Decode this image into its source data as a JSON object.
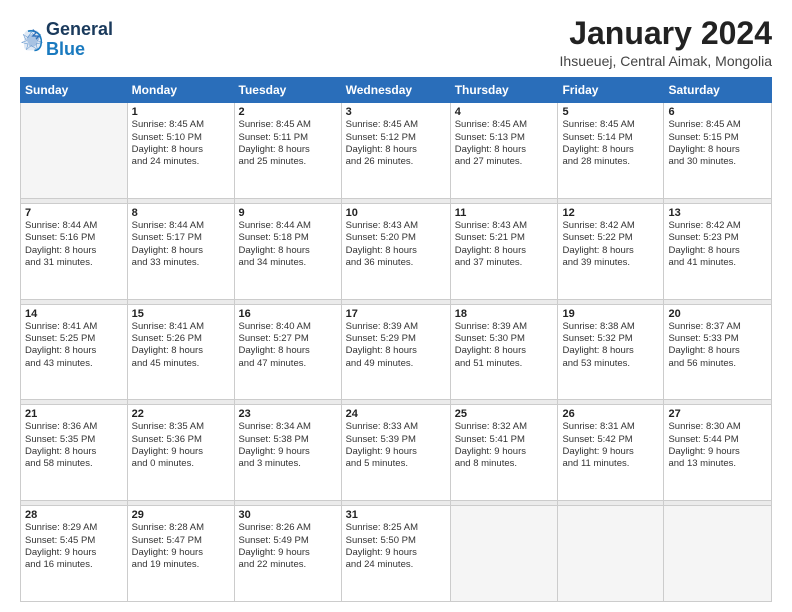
{
  "header": {
    "logo_line1": "General",
    "logo_line2": "Blue",
    "month_title": "January 2024",
    "location": "Ihsueuej, Central Aimak, Mongolia"
  },
  "days_of_week": [
    "Sunday",
    "Monday",
    "Tuesday",
    "Wednesday",
    "Thursday",
    "Friday",
    "Saturday"
  ],
  "weeks": [
    {
      "days": [
        {
          "num": "",
          "content": ""
        },
        {
          "num": "1",
          "content": "Sunrise: 8:45 AM\nSunset: 5:10 PM\nDaylight: 8 hours\nand 24 minutes."
        },
        {
          "num": "2",
          "content": "Sunrise: 8:45 AM\nSunset: 5:11 PM\nDaylight: 8 hours\nand 25 minutes."
        },
        {
          "num": "3",
          "content": "Sunrise: 8:45 AM\nSunset: 5:12 PM\nDaylight: 8 hours\nand 26 minutes."
        },
        {
          "num": "4",
          "content": "Sunrise: 8:45 AM\nSunset: 5:13 PM\nDaylight: 8 hours\nand 27 minutes."
        },
        {
          "num": "5",
          "content": "Sunrise: 8:45 AM\nSunset: 5:14 PM\nDaylight: 8 hours\nand 28 minutes."
        },
        {
          "num": "6",
          "content": "Sunrise: 8:45 AM\nSunset: 5:15 PM\nDaylight: 8 hours\nand 30 minutes."
        }
      ]
    },
    {
      "days": [
        {
          "num": "7",
          "content": "Sunrise: 8:44 AM\nSunset: 5:16 PM\nDaylight: 8 hours\nand 31 minutes."
        },
        {
          "num": "8",
          "content": "Sunrise: 8:44 AM\nSunset: 5:17 PM\nDaylight: 8 hours\nand 33 minutes."
        },
        {
          "num": "9",
          "content": "Sunrise: 8:44 AM\nSunset: 5:18 PM\nDaylight: 8 hours\nand 34 minutes."
        },
        {
          "num": "10",
          "content": "Sunrise: 8:43 AM\nSunset: 5:20 PM\nDaylight: 8 hours\nand 36 minutes."
        },
        {
          "num": "11",
          "content": "Sunrise: 8:43 AM\nSunset: 5:21 PM\nDaylight: 8 hours\nand 37 minutes."
        },
        {
          "num": "12",
          "content": "Sunrise: 8:42 AM\nSunset: 5:22 PM\nDaylight: 8 hours\nand 39 minutes."
        },
        {
          "num": "13",
          "content": "Sunrise: 8:42 AM\nSunset: 5:23 PM\nDaylight: 8 hours\nand 41 minutes."
        }
      ]
    },
    {
      "days": [
        {
          "num": "14",
          "content": "Sunrise: 8:41 AM\nSunset: 5:25 PM\nDaylight: 8 hours\nand 43 minutes."
        },
        {
          "num": "15",
          "content": "Sunrise: 8:41 AM\nSunset: 5:26 PM\nDaylight: 8 hours\nand 45 minutes."
        },
        {
          "num": "16",
          "content": "Sunrise: 8:40 AM\nSunset: 5:27 PM\nDaylight: 8 hours\nand 47 minutes."
        },
        {
          "num": "17",
          "content": "Sunrise: 8:39 AM\nSunset: 5:29 PM\nDaylight: 8 hours\nand 49 minutes."
        },
        {
          "num": "18",
          "content": "Sunrise: 8:39 AM\nSunset: 5:30 PM\nDaylight: 8 hours\nand 51 minutes."
        },
        {
          "num": "19",
          "content": "Sunrise: 8:38 AM\nSunset: 5:32 PM\nDaylight: 8 hours\nand 53 minutes."
        },
        {
          "num": "20",
          "content": "Sunrise: 8:37 AM\nSunset: 5:33 PM\nDaylight: 8 hours\nand 56 minutes."
        }
      ]
    },
    {
      "days": [
        {
          "num": "21",
          "content": "Sunrise: 8:36 AM\nSunset: 5:35 PM\nDaylight: 8 hours\nand 58 minutes."
        },
        {
          "num": "22",
          "content": "Sunrise: 8:35 AM\nSunset: 5:36 PM\nDaylight: 9 hours\nand 0 minutes."
        },
        {
          "num": "23",
          "content": "Sunrise: 8:34 AM\nSunset: 5:38 PM\nDaylight: 9 hours\nand 3 minutes."
        },
        {
          "num": "24",
          "content": "Sunrise: 8:33 AM\nSunset: 5:39 PM\nDaylight: 9 hours\nand 5 minutes."
        },
        {
          "num": "25",
          "content": "Sunrise: 8:32 AM\nSunset: 5:41 PM\nDaylight: 9 hours\nand 8 minutes."
        },
        {
          "num": "26",
          "content": "Sunrise: 8:31 AM\nSunset: 5:42 PM\nDaylight: 9 hours\nand 11 minutes."
        },
        {
          "num": "27",
          "content": "Sunrise: 8:30 AM\nSunset: 5:44 PM\nDaylight: 9 hours\nand 13 minutes."
        }
      ]
    },
    {
      "days": [
        {
          "num": "28",
          "content": "Sunrise: 8:29 AM\nSunset: 5:45 PM\nDaylight: 9 hours\nand 16 minutes."
        },
        {
          "num": "29",
          "content": "Sunrise: 8:28 AM\nSunset: 5:47 PM\nDaylight: 9 hours\nand 19 minutes."
        },
        {
          "num": "30",
          "content": "Sunrise: 8:26 AM\nSunset: 5:49 PM\nDaylight: 9 hours\nand 22 minutes."
        },
        {
          "num": "31",
          "content": "Sunrise: 8:25 AM\nSunset: 5:50 PM\nDaylight: 9 hours\nand 24 minutes."
        },
        {
          "num": "",
          "content": ""
        },
        {
          "num": "",
          "content": ""
        },
        {
          "num": "",
          "content": ""
        }
      ]
    }
  ]
}
